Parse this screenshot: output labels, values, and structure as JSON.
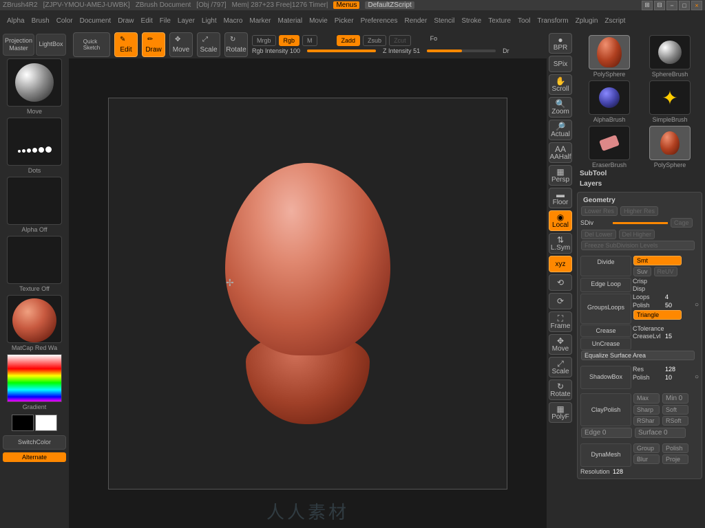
{
  "titlebar": {
    "app": "ZBrush4R2",
    "doc": "[ZJPV-YMOU-AMEJ-UWBK]",
    "docname": "ZBrush Document",
    "obj": "[Obj /797]",
    "mem": "Mem| 287+23 Free|1276 Timer|",
    "menus": "Menus",
    "script": "DefaultZScript"
  },
  "menu": [
    "Alpha",
    "Brush",
    "Color",
    "Document",
    "Draw",
    "Edit",
    "File",
    "Layer",
    "Light",
    "Macro",
    "Marker",
    "Material",
    "Movie",
    "Picker",
    "Preferences",
    "Render",
    "Stencil",
    "Stroke",
    "Texture",
    "Tool",
    "Transform",
    "Zplugin",
    "Zscript"
  ],
  "left": {
    "proj": "Projection\nMaster",
    "lightbox": "LightBox",
    "move": "Move",
    "dots": "Dots",
    "alpha": "Alpha Off",
    "texture": "Texture Off",
    "material": "MatCap Red Wa",
    "gradient": "Gradient",
    "switch": "SwitchColor",
    "alternate": "Alternate"
  },
  "toolbar": {
    "quick": "Quick\nSketch",
    "edit": "Edit",
    "draw": "Draw",
    "move": "Move",
    "scale": "Scale",
    "rotate": "Rotate",
    "mrgb": "Mrgb",
    "rgb": "Rgb",
    "m": "M",
    "zadd": "Zadd",
    "zsub": "Zsub",
    "zcut": "Zcut",
    "fo": "Fo",
    "rgbint": "Rgb Intensity 100",
    "zint": "Z Intensity 51",
    "dr": "Dr"
  },
  "rtools": {
    "bpr": "BPR",
    "spix": "SPix",
    "scroll": "Scroll",
    "zoom": "Zoom",
    "actual": "Actual",
    "aahalf": "AAHalf",
    "persp": "Persp",
    "floor": "Floor",
    "local": "Local",
    "lsym": "L.Sym",
    "xyz": "xyz",
    "frame": "Frame",
    "move": "Move",
    "scale": "Scale",
    "rotate": "Rotate",
    "polyf": "PolyF"
  },
  "brushes": [
    "PolySphere",
    "SphereBrush",
    "AlphaBrush",
    "SimpleBrush",
    "EraserBrush",
    "PolySphere"
  ],
  "subtool": "SubTool",
  "layers": "Layers",
  "geo": {
    "title": "Geometry",
    "lower": "Lower Res",
    "higher": "Higher Res",
    "sdiv": "SDiv",
    "cage": "Cage",
    "dellower": "Del Lower",
    "delhigher": "Del Higher",
    "freeze": "Freeze SubDivision Levels",
    "divide": "Divide",
    "smt": "Smt",
    "suv": "Suv",
    "reuv": "ReUV",
    "edgeloop": "Edge Loop",
    "crisp": "Crisp",
    "disp": "Disp",
    "groupsloops": "GroupsLoops",
    "loops": "Loops",
    "loopsval": "4",
    "polish": "Polish",
    "polishval": "50",
    "triangle": "Triangle",
    "crease": "Crease",
    "uncrease": "UnCrease",
    "ctol": "CTolerance",
    "creaselvl": "CreaseLvl",
    "creaselvlval": "15",
    "equalize": "Equalize Surface Area",
    "shadowbox": "ShadowBox",
    "res": "Res",
    "resval": "128",
    "polish2": "Polish",
    "polish2val": "10",
    "claypolish": "ClayPolish",
    "max": "Max",
    "min": "Min",
    "minval": "0",
    "sharp": "Sharp",
    "soft": "Soft",
    "rshar": "RShar",
    "rsoft": "RSoft",
    "edge": "Edge",
    "edgeval": "0",
    "surface": "Surface",
    "surfaceval": "0",
    "dynamesh": "DynaMesh",
    "group": "Group",
    "polish3": "Polish",
    "blur": "Blur",
    "proj": "Proje",
    "resolution": "Resolution",
    "resolutionval": "128"
  },
  "watermark": "人人素材"
}
